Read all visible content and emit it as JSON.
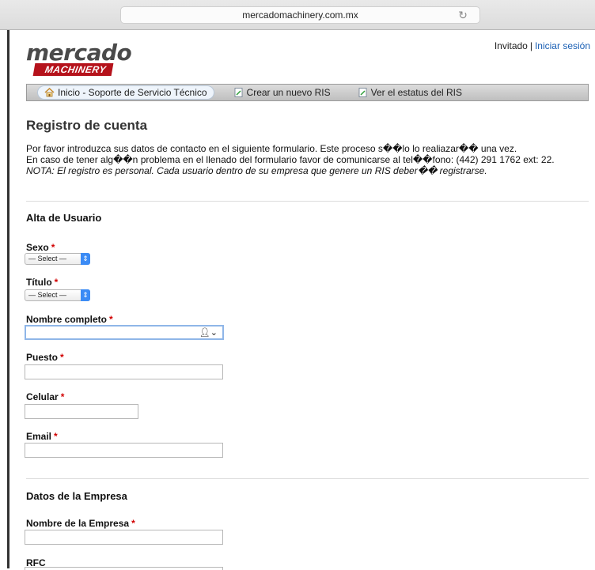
{
  "browser": {
    "url": "mercadomachinery.com.mx"
  },
  "header": {
    "logo_top": "mercado",
    "logo_bottom": "MACHINERY",
    "guest_label": "Invitado",
    "separator": "|",
    "login_link": "Iniciar sesión"
  },
  "nav": {
    "items": [
      {
        "label": "Inicio - Soporte de Servicio Técnico"
      },
      {
        "label": "Crear un nuevo RIS"
      },
      {
        "label": "Ver el estatus del RIS"
      }
    ]
  },
  "page": {
    "title": "Registro de cuenta",
    "intro_line1": "Por favor introduzca sus datos de contacto en el siguiente formulario. Este proceso s��lo lo realiazar�� una vez.",
    "intro_line2": "En caso de tener alg��n problema en el llenado del formulario favor de comunicarse al tel��fono: (442) 291 1762 ext: 22.",
    "intro_note": "NOTA: El registro es personal. Cada usuario dentro de su empresa que genere un RIS deber�� registrarse."
  },
  "sections": {
    "user": "Alta de Usuario",
    "company": "Datos de la Empresa"
  },
  "fields": {
    "required_mark": "*",
    "sexo": {
      "label": "Sexo",
      "value": "— Select —"
    },
    "titulo": {
      "label": "Título",
      "value": "— Select —"
    },
    "nombre": {
      "label": "Nombre completo",
      "value": ""
    },
    "puesto": {
      "label": "Puesto",
      "value": ""
    },
    "celular": {
      "label": "Celular",
      "value": ""
    },
    "email": {
      "label": "Email",
      "value": ""
    },
    "empresa": {
      "label": "Nombre de la Empresa",
      "value": ""
    },
    "rfc": {
      "label": "RFC"
    }
  },
  "icons": {
    "home": "home-icon",
    "document": "document-icon",
    "reload": "reload-icon",
    "person": "person-icon",
    "select_arrow": "select-arrows-icon"
  }
}
